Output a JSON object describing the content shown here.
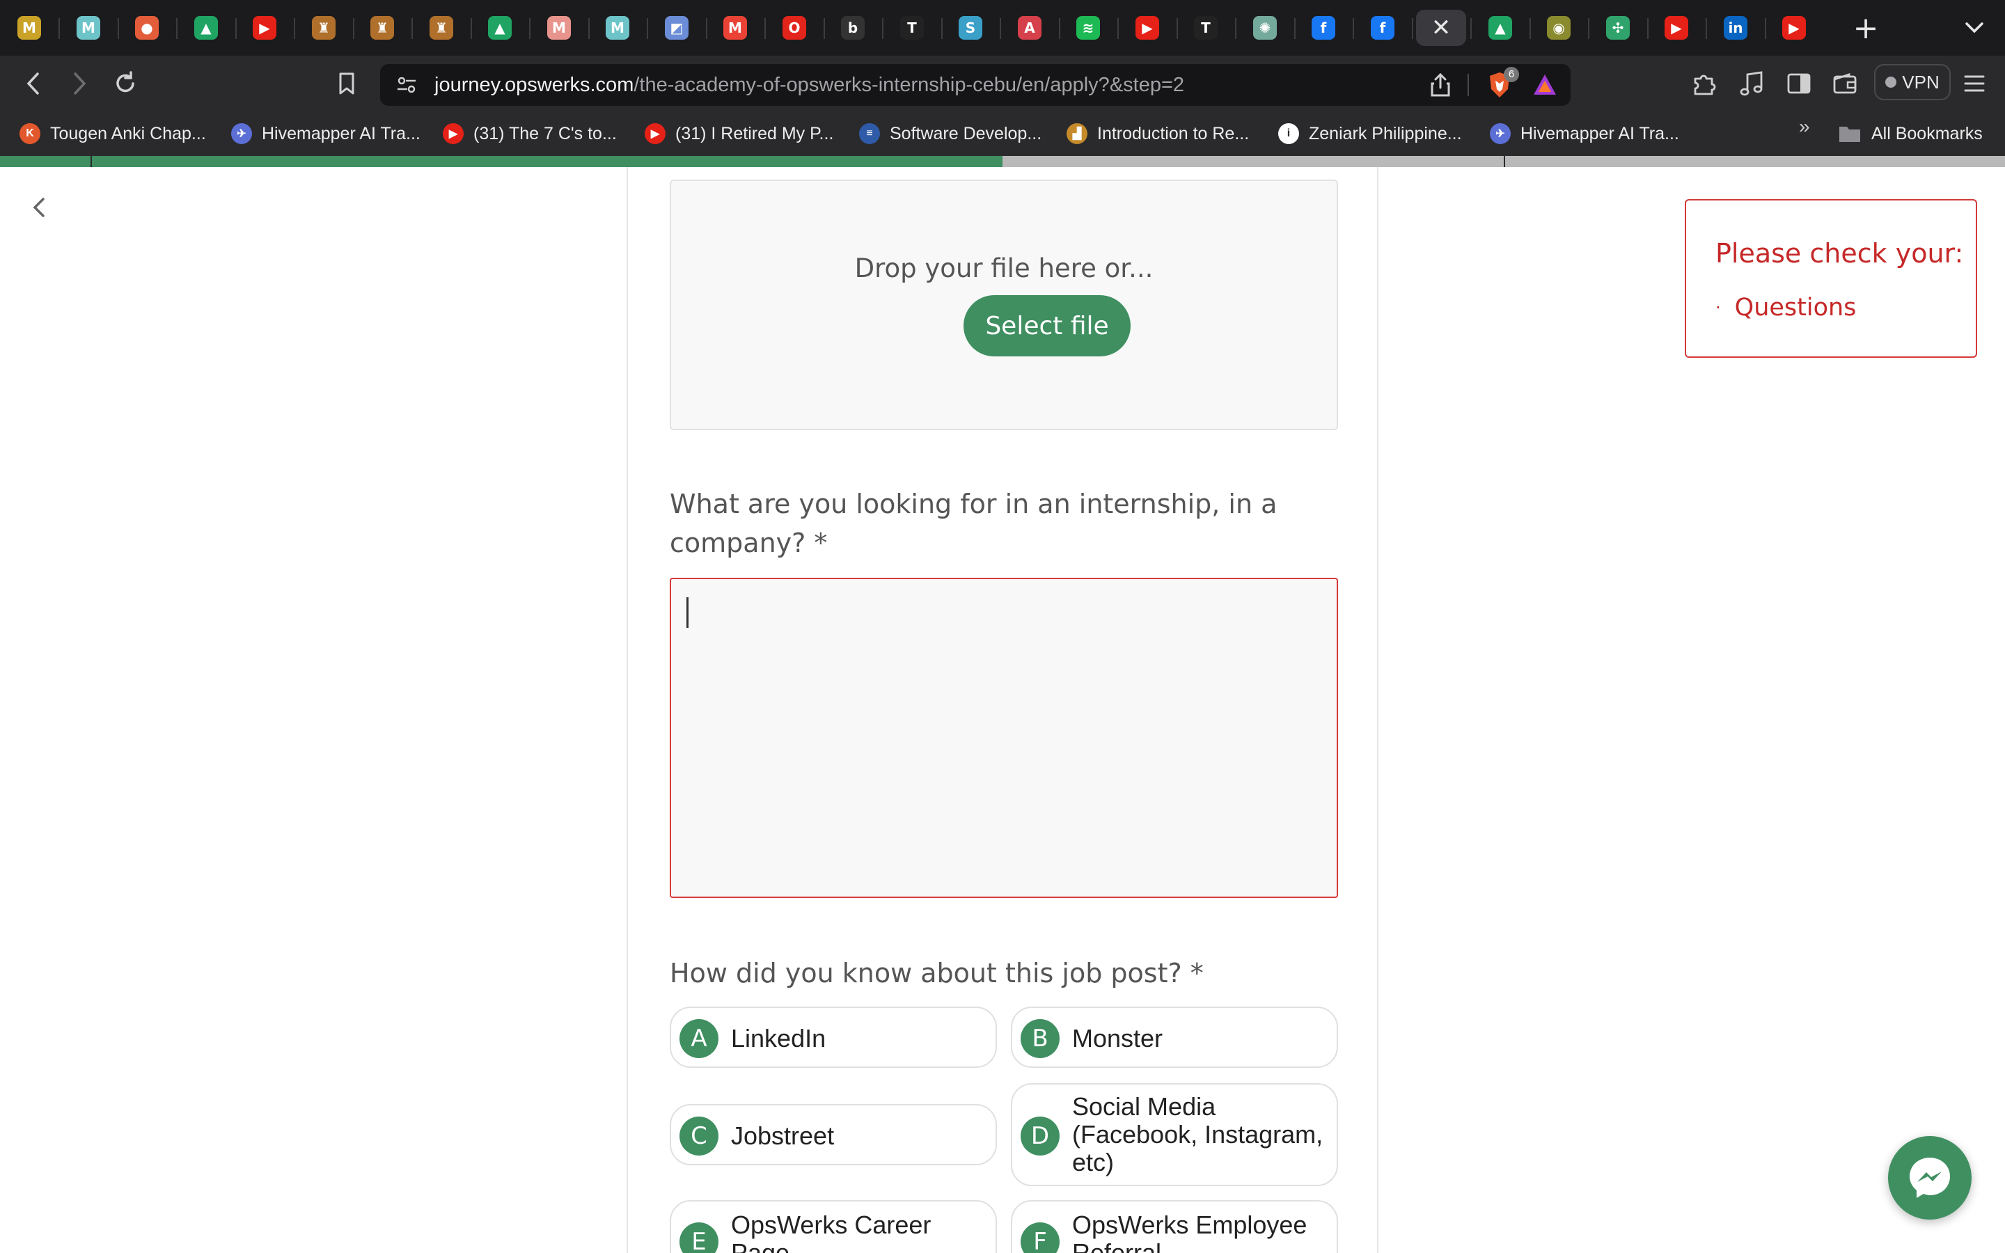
{
  "browser": {
    "tabs": [
      {
        "icon": "app-logo-icon",
        "glyph": "M",
        "color": "#c9a227"
      },
      {
        "icon": "m-icon",
        "glyph": "M",
        "color": "#6cc3c8"
      },
      {
        "icon": "app-icon",
        "glyph": "●",
        "color": "#e35d3a"
      },
      {
        "icon": "google-drive-icon",
        "glyph": "▲",
        "color": "#1fa463"
      },
      {
        "icon": "youtube-icon",
        "glyph": "▶",
        "color": "#e62117"
      },
      {
        "icon": "crest-icon",
        "glyph": "♜",
        "color": "#b0702b"
      },
      {
        "icon": "crest-icon",
        "glyph": "♜",
        "color": "#b0702b"
      },
      {
        "icon": "crest-icon",
        "glyph": "♜",
        "color": "#b0702b"
      },
      {
        "icon": "google-drive-icon",
        "glyph": "▲",
        "color": "#1fa463"
      },
      {
        "icon": "m-icon",
        "glyph": "M",
        "color": "#e8948c"
      },
      {
        "icon": "m-icon",
        "glyph": "M",
        "color": "#6cc3c8"
      },
      {
        "icon": "image-icon",
        "glyph": "◩",
        "color": "#6b8cd6"
      },
      {
        "icon": "gmail-icon",
        "glyph": "M",
        "color": "#ea4335"
      },
      {
        "icon": "oracle-icon",
        "glyph": "O",
        "color": "#e2241b"
      },
      {
        "icon": "app-icon",
        "glyph": "b",
        "color": "#333333"
      },
      {
        "icon": "tradingview-icon",
        "glyph": "T",
        "color": "#222222"
      },
      {
        "icon": "s-icon",
        "glyph": "S",
        "color": "#3aa0c8"
      },
      {
        "icon": "angular-icon",
        "glyph": "A",
        "color": "#d6404a"
      },
      {
        "icon": "spotify-icon",
        "glyph": "≋",
        "color": "#1db954"
      },
      {
        "icon": "youtube-icon",
        "glyph": "▶",
        "color": "#e62117"
      },
      {
        "icon": "tradingview-icon",
        "glyph": "T",
        "color": "#222222"
      },
      {
        "icon": "chatgpt-icon",
        "glyph": "✺",
        "color": "#74aa9c"
      },
      {
        "icon": "facebook-icon",
        "glyph": "f",
        "color": "#1877f2"
      },
      {
        "icon": "facebook-icon",
        "glyph": "f",
        "color": "#1877f2"
      },
      {
        "icon": "close-icon",
        "glyph": "✕",
        "color": "#3a3a3e",
        "active": true
      },
      {
        "icon": "google-drive-icon",
        "glyph": "▲",
        "color": "#1fa463"
      },
      {
        "icon": "app-icon",
        "glyph": "◉",
        "color": "#8a8a2e"
      },
      {
        "icon": "butterfly-icon",
        "glyph": "✣",
        "color": "#2fa36b"
      },
      {
        "icon": "youtube-icon",
        "glyph": "▶",
        "color": "#e62117"
      },
      {
        "icon": "linkedin-icon",
        "glyph": "in",
        "color": "#0a66c2"
      },
      {
        "icon": "youtube-icon",
        "glyph": "▶",
        "color": "#e62117"
      }
    ],
    "url_host": "journey.opswerks.com",
    "url_path": "/the-academy-of-opswerks-internship-cebu/en/apply?&step=2",
    "shield_count": "6",
    "vpn_label": "VPN",
    "bookmarks": [
      {
        "label": "Tougen Anki Chap...",
        "icon": "site-icon",
        "color": "#e3572c",
        "glyph": "K"
      },
      {
        "label": "Hivemapper AI Tra...",
        "icon": "site-icon",
        "color": "#5b6fd6",
        "glyph": "✈"
      },
      {
        "label": "(31) The 7 C's to...",
        "icon": "youtube-icon",
        "color": "#e62117",
        "glyph": "▶"
      },
      {
        "label": "(31) I Retired My P...",
        "icon": "youtube-icon",
        "color": "#e62117",
        "glyph": "▶"
      },
      {
        "label": "Software Develop...",
        "icon": "site-icon",
        "color": "#2f5aa8",
        "glyph": "≡"
      },
      {
        "label": "Introduction to Re...",
        "icon": "site-icon",
        "color": "#c58a2a",
        "glyph": "▟"
      },
      {
        "label": "Zeniark Philippine...",
        "icon": "info-icon",
        "color": "#ffffff",
        "glyph": "i"
      },
      {
        "label": "Hivemapper AI Tra...",
        "icon": "site-icon",
        "color": "#5b6fd6",
        "glyph": "✈"
      }
    ],
    "bookmarks_overflow": "»",
    "all_bookmarks_label": "All Bookmarks",
    "load_progress": 0.5
  },
  "form": {
    "drop_text": "Drop your file here or...",
    "select_file_label": "Select file",
    "q_internship_line1": "What are you looking for in an internship, in a",
    "q_internship_line2": "company? *",
    "internship_answer": "",
    "q_source": "How did you know about this job post? *",
    "options": [
      {
        "letter": "A",
        "label": "LinkedIn"
      },
      {
        "letter": "B",
        "label": "Monster"
      },
      {
        "letter": "C",
        "label": "Jobstreet"
      },
      {
        "letter": "D",
        "label": "Social Media (Facebook, Instagram, etc)"
      },
      {
        "letter": "E",
        "label": "OpsWerks Career Page"
      },
      {
        "letter": "F",
        "label": "OpsWerks Employee Referral"
      }
    ]
  },
  "alert": {
    "title": "Please check your:",
    "items": [
      "Questions"
    ]
  },
  "colors": {
    "accent": "#3f8f61",
    "error": "#d23a3a"
  }
}
